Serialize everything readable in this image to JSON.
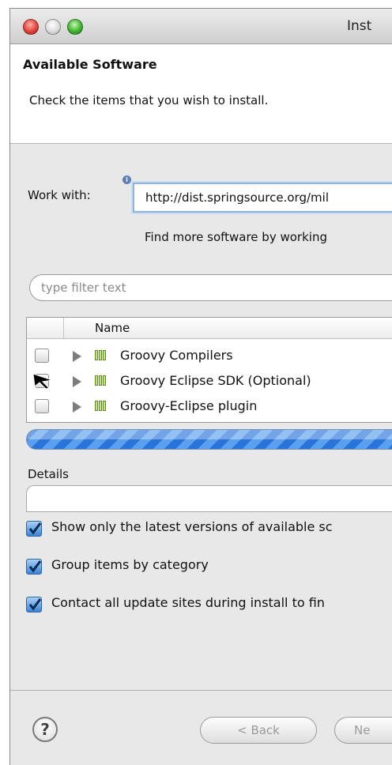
{
  "window": {
    "title": "Inst"
  },
  "header": {
    "title": "Available Software",
    "description": "Check the items that you wish to install."
  },
  "work_with": {
    "label": "Work with:",
    "value": "http://dist.springsource.org/mil",
    "more_link": "Find more software by working"
  },
  "filter": {
    "placeholder": "type filter text"
  },
  "tree": {
    "column_name": "Name",
    "rows": [
      {
        "label": "Groovy Compilers",
        "checked": false
      },
      {
        "label": "Groovy Eclipse SDK (Optional)",
        "checked": false
      },
      {
        "label": "Groovy-Eclipse plugin",
        "checked": false
      }
    ]
  },
  "details": {
    "label": "Details"
  },
  "options": [
    {
      "label": "Show only the latest versions of available sc",
      "checked": true
    },
    {
      "label": "Group items by category",
      "checked": true
    },
    {
      "label": "Contact all update sites during install to fin",
      "checked": true
    }
  ],
  "footer": {
    "back_label": "< Back",
    "next_label": "Ne"
  },
  "colors": {
    "accent": "#3a83d4",
    "progress": "#2a73d8"
  }
}
